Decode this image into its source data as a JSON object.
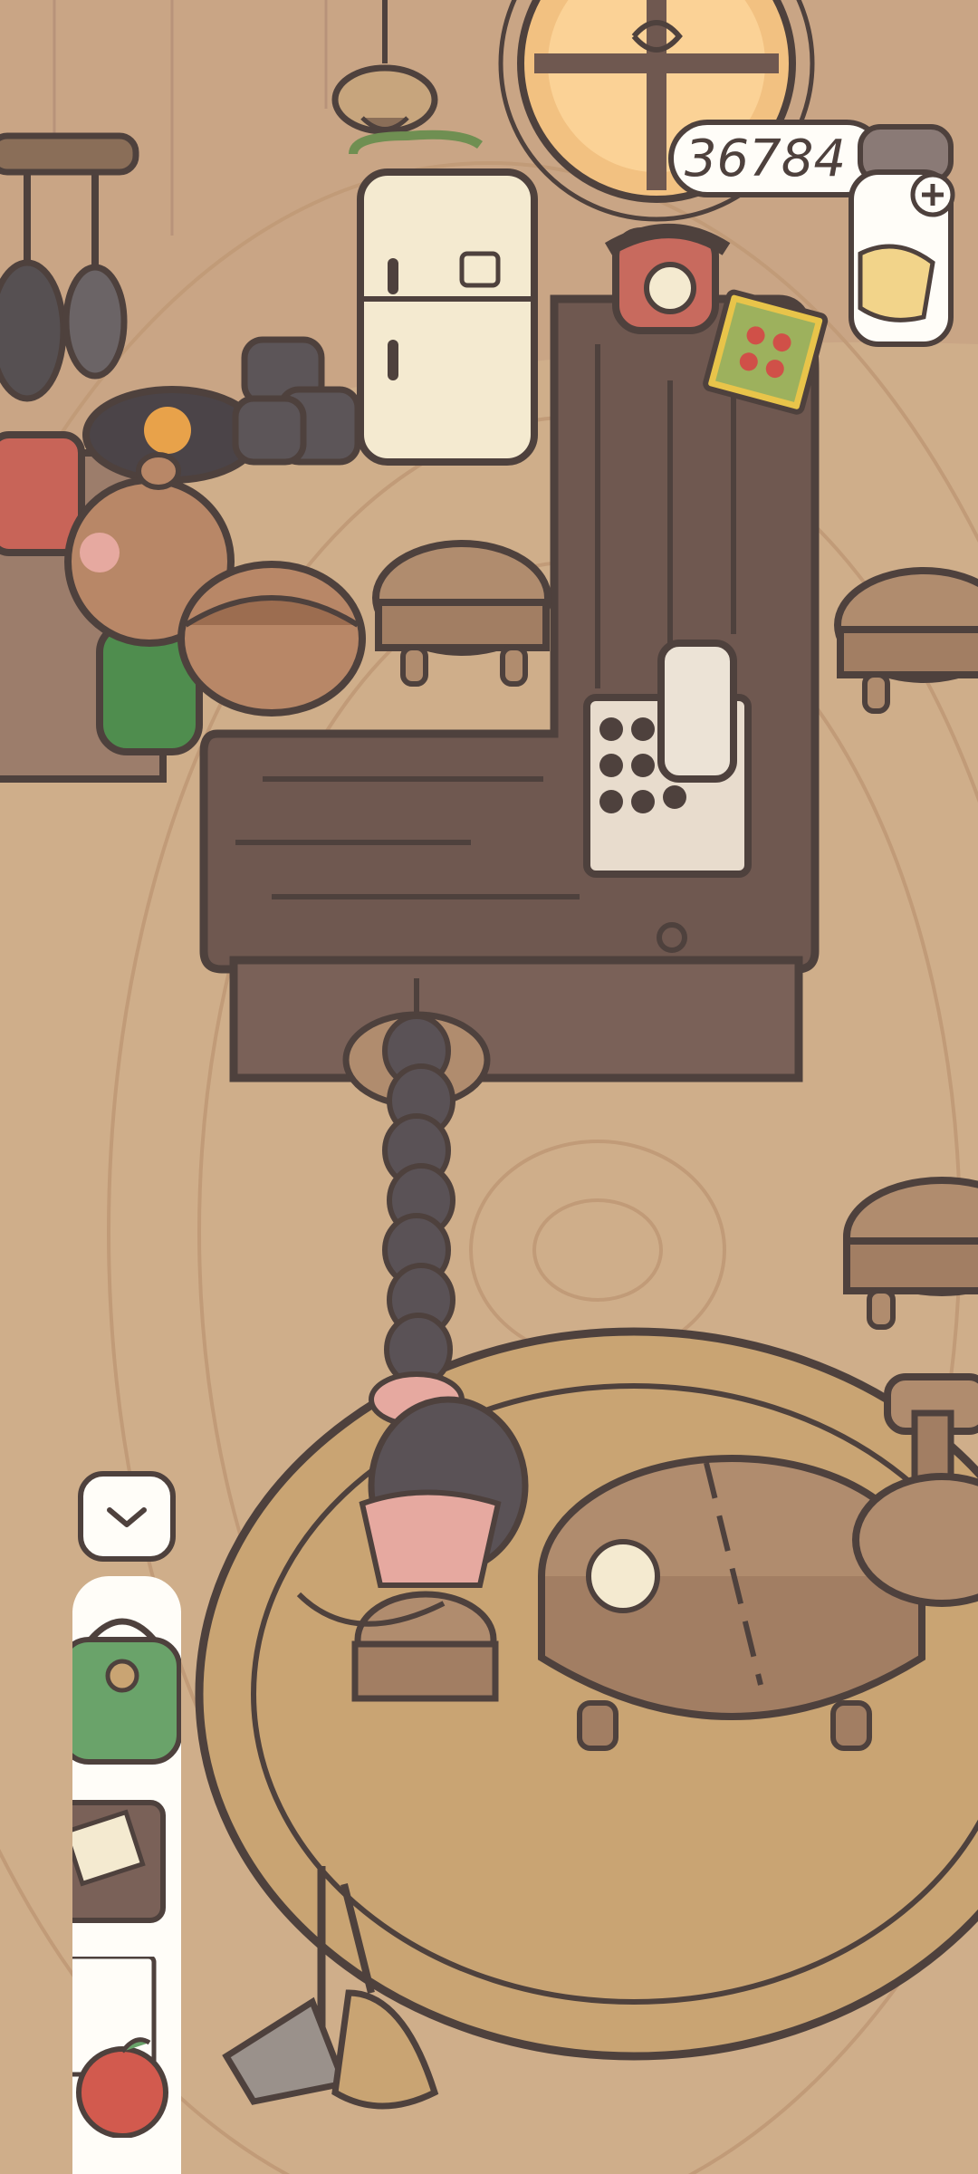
{
  "hud": {
    "coin_count": "36784",
    "coin_jar_icon": "coin-jar-plus-icon",
    "collapse_icon": "chevron-down-icon"
  },
  "side_menu": {
    "items": [
      {
        "name": "backpack",
        "icon": "backpack-icon"
      },
      {
        "name": "notebook",
        "icon": "notebook-icon"
      },
      {
        "name": "fruit",
        "icon": "apple-icon"
      }
    ]
  },
  "scene": {
    "characters": [
      {
        "name": "shopkeeper",
        "icon": "squirrel-chef-icon"
      },
      {
        "name": "mouse-stack",
        "icon": "mice-stack-icon"
      }
    ],
    "palette": {
      "floor": "#cfae8a",
      "outline": "#4e413d",
      "counter": "#6f5850",
      "rug": "#c9a473",
      "wood": "#b08c6e"
    }
  }
}
